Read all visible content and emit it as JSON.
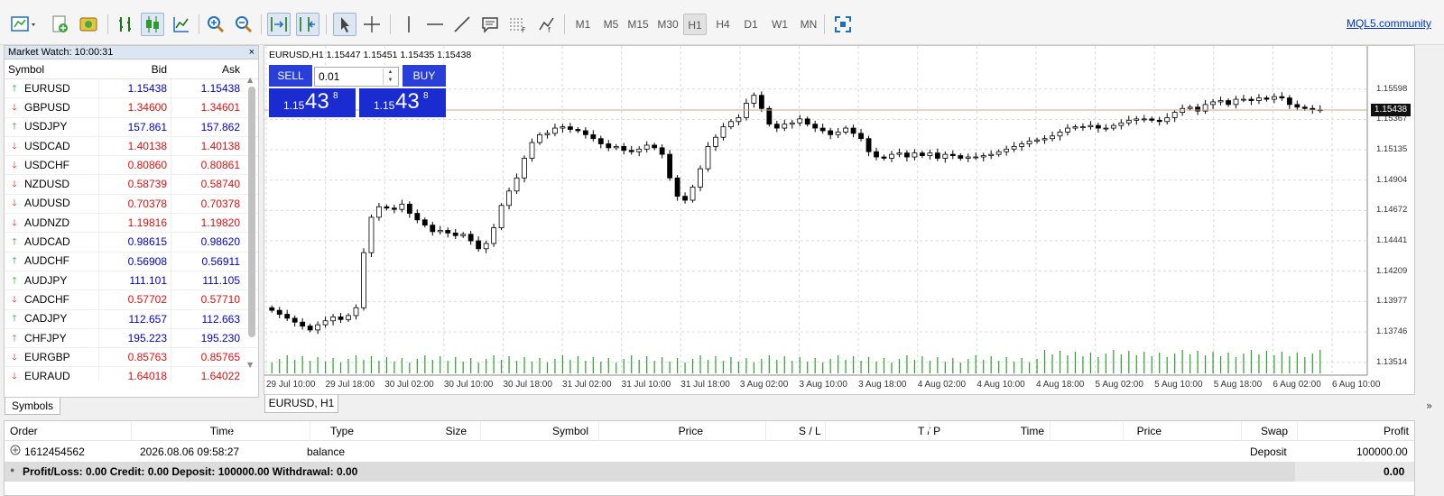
{
  "toolbar": {
    "timeframes": [
      "M1",
      "M5",
      "M15",
      "M30",
      "H1",
      "H4",
      "D1",
      "W1",
      "MN"
    ],
    "active_timeframe": "H1",
    "community_link": "MQL5.community"
  },
  "market_watch": {
    "title": "Market Watch: 10:00:31",
    "close": "×",
    "columns": {
      "symbol": "Symbol",
      "bid": "Bid",
      "ask": "Ask"
    },
    "rows": [
      {
        "symbol": "EURUSD",
        "bid": "1.15438",
        "ask": "1.15438",
        "dir": "up"
      },
      {
        "symbol": "GBPUSD",
        "bid": "1.34600",
        "ask": "1.34601",
        "dir": "down"
      },
      {
        "symbol": "USDJPY",
        "bid": "157.861",
        "ask": "157.862",
        "dir": "up"
      },
      {
        "symbol": "USDCAD",
        "bid": "1.40138",
        "ask": "1.40138",
        "dir": "down"
      },
      {
        "symbol": "USDCHF",
        "bid": "0.80860",
        "ask": "0.80861",
        "dir": "down"
      },
      {
        "symbol": "NZDUSD",
        "bid": "0.58739",
        "ask": "0.58740",
        "dir": "down"
      },
      {
        "symbol": "AUDUSD",
        "bid": "0.70378",
        "ask": "0.70378",
        "dir": "down"
      },
      {
        "symbol": "AUDNZD",
        "bid": "1.19816",
        "ask": "1.19820",
        "dir": "down"
      },
      {
        "symbol": "AUDCAD",
        "bid": "0.98615",
        "ask": "0.98620",
        "dir": "up"
      },
      {
        "symbol": "AUDCHF",
        "bid": "0.56908",
        "ask": "0.56911",
        "dir": "up"
      },
      {
        "symbol": "AUDJPY",
        "bid": "111.101",
        "ask": "111.105",
        "dir": "up"
      },
      {
        "symbol": "CADCHF",
        "bid": "0.57702",
        "ask": "0.57710",
        "dir": "down"
      },
      {
        "symbol": "CADJPY",
        "bid": "112.657",
        "ask": "112.663",
        "dir": "up"
      },
      {
        "symbol": "CHFJPY",
        "bid": "195.223",
        "ask": "195.230",
        "dir": "up"
      },
      {
        "symbol": "EURGBP",
        "bid": "0.85763",
        "ask": "0.85765",
        "dir": "down"
      },
      {
        "symbol": "EURAUD",
        "bid": "1.64018",
        "ask": "1.64022",
        "dir": "down"
      }
    ],
    "tab": "Symbols"
  },
  "chart": {
    "ohlc_header": "EURUSD,H1  1.15447 1.15451 1.15435 1.15438",
    "tab": "EURUSD, H1",
    "tab_more": "»",
    "one_click": {
      "sell_label": "SELL",
      "buy_label": "BUY",
      "lot": "0.01",
      "sell_price": {
        "prefix": "1.15",
        "big": "43",
        "sup": "8"
      },
      "buy_price": {
        "prefix": "1.15",
        "big": "43",
        "sup": "8"
      }
    },
    "current_price": "1.15438",
    "y_labels": [
      "1.15598",
      "1.15367",
      "1.15135",
      "1.14904",
      "1.14672",
      "1.14441",
      "1.14209",
      "1.13977",
      "1.13746",
      "1.13514"
    ],
    "x_labels": [
      "29 Jul 10:00",
      "29 Jul 18:00",
      "30 Jul 02:00",
      "30 Jul 10:00",
      "30 Jul 18:00",
      "31 Jul 02:00",
      "31 Jul 10:00",
      "31 Jul 18:00",
      "3 Aug 02:00",
      "3 Aug 10:00",
      "3 Aug 18:00",
      "4 Aug 02:00",
      "4 Aug 10:00",
      "4 Aug 18:00",
      "5 Aug 02:00",
      "5 Aug 10:00",
      "5 Aug 18:00",
      "6 Aug 02:00",
      "6 Aug 10:00"
    ]
  },
  "chart_data": {
    "type": "candlestick",
    "symbol": "EURUSD",
    "timeframe": "H1",
    "ylim": [
      1.1345,
      1.1572
    ],
    "grid": true,
    "series_close": [
      1.1391,
      1.1388,
      1.1385,
      1.1382,
      1.1379,
      1.1376,
      1.138,
      1.1383,
      1.1386,
      1.1384,
      1.1387,
      1.1393,
      1.1435,
      1.1462,
      1.147,
      1.1469,
      1.1468,
      1.1472,
      1.1465,
      1.146,
      1.1456,
      1.1451,
      1.1452,
      1.145,
      1.1448,
      1.1449,
      1.1444,
      1.1438,
      1.1442,
      1.1454,
      1.1471,
      1.1482,
      1.1492,
      1.1507,
      1.1519,
      1.1525,
      1.1526,
      1.153,
      1.1531,
      1.1529,
      1.1528,
      1.1525,
      1.1522,
      1.1518,
      1.1515,
      1.1516,
      1.1513,
      1.1512,
      1.1514,
      1.1517,
      1.1515,
      1.151,
      1.1492,
      1.1478,
      1.1475,
      1.1485,
      1.1499,
      1.1516,
      1.1523,
      1.1531,
      1.1535,
      1.1538,
      1.1549,
      1.1555,
      1.1545,
      1.1533,
      1.153,
      1.1533,
      1.1534,
      1.1537,
      1.1533,
      1.153,
      1.1528,
      1.1525,
      1.1527,
      1.153,
      1.1526,
      1.1522,
      1.1512,
      1.1508,
      1.1507,
      1.151,
      1.1511,
      1.1508,
      1.1511,
      1.1509,
      1.1511,
      1.1507,
      1.151,
      1.1509,
      1.1507,
      1.1508,
      1.1508,
      1.1509,
      1.151,
      1.1512,
      1.1514,
      1.1516,
      1.1518,
      1.152,
      1.1521,
      1.1522,
      1.1524,
      1.1527,
      1.153,
      1.1531,
      1.1531,
      1.1532,
      1.153,
      1.153,
      1.1532,
      1.1534,
      1.1536,
      1.1537,
      1.1537,
      1.1536,
      1.1535,
      1.1538,
      1.1542,
      1.1545,
      1.1546,
      1.1543,
      1.1548,
      1.155,
      1.1551,
      1.1548,
      1.1552,
      1.1552,
      1.1551,
      1.1553,
      1.1552,
      1.1554,
      1.1553,
      1.1548,
      1.1546,
      1.1545,
      1.1544,
      1.15438
    ]
  },
  "toolbox": {
    "columns": [
      "Order",
      "Time",
      "Type",
      "Size",
      "Symbol",
      "Price",
      "S / L",
      "T / P",
      "Time",
      "Price",
      "Swap",
      "Profit"
    ],
    "row": {
      "order": "1612454562",
      "time": "2026.08.06 09:58:27",
      "type": "balance",
      "swap": "Deposit",
      "profit": "100000.00"
    },
    "summary": "Profit/Loss: 0.00  Credit: 0.00  Deposit: 100000.00  Withdrawal: 0.00",
    "summary_total": "0.00"
  }
}
